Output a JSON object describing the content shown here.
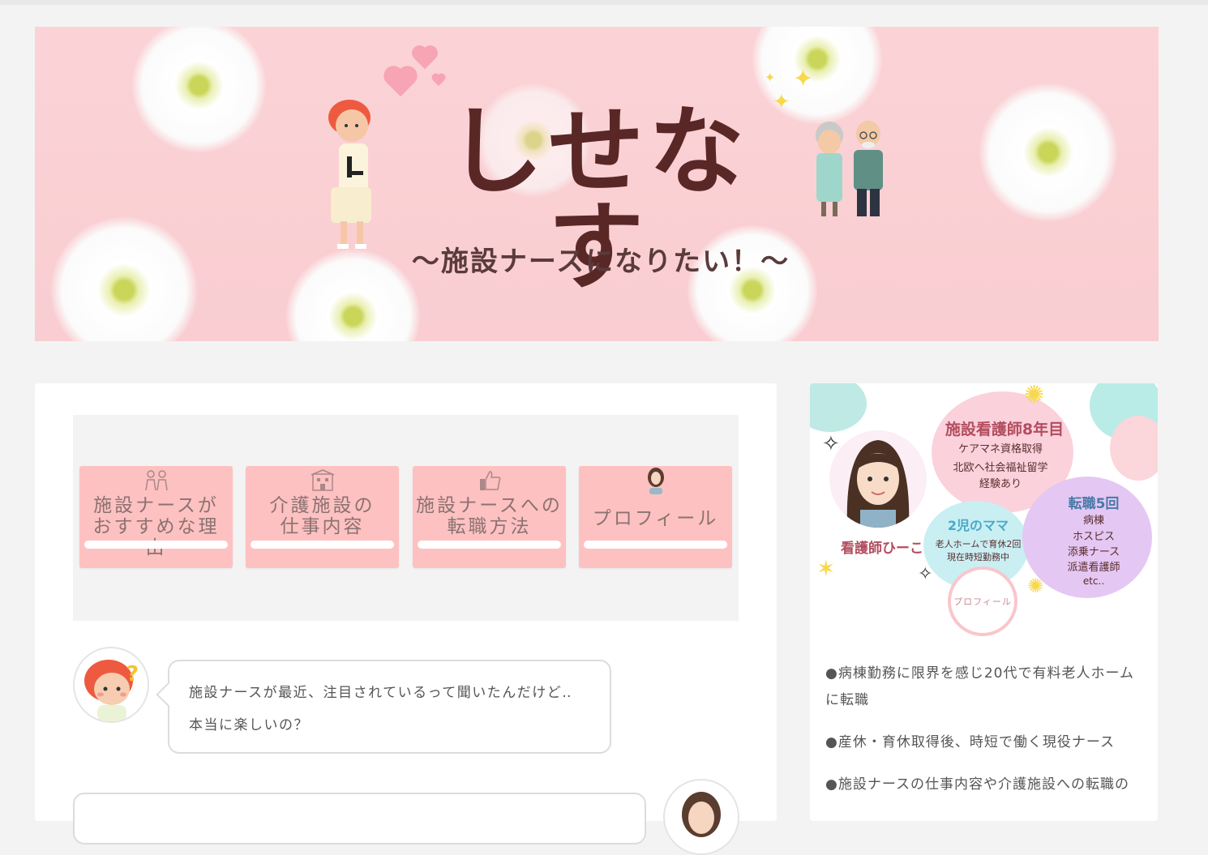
{
  "header": {
    "title": "しせなす",
    "subtitle": "〜施設ナースになりたい！〜"
  },
  "nav": {
    "cards": [
      {
        "label": "施設ナースが\nおすすめな理由",
        "icon": "family-icon"
      },
      {
        "label": "介護施設の\n仕事内容",
        "icon": "building-icon"
      },
      {
        "label": "施設ナースへの\n転職方法",
        "icon": "thumbs-up-icon"
      },
      {
        "label": "プロフィール",
        "icon": "nurse-avatar-icon"
      }
    ]
  },
  "conversation": {
    "line1": "施設ナースが最近、注目されているって聞いたんだけど‥",
    "line2": "本当に楽しいの？"
  },
  "profile_card": {
    "heading": "施設看護師8年目",
    "line1": "ケアマネ資格取得",
    "line2": "北欧へ社会福祉留学",
    "line3": "経験あり",
    "name": "看護師ひーこ",
    "mama": "2児のママ",
    "work1": "老人ホームで育休2回",
    "work2": "現在時短勤務中",
    "career_title": "転職5回",
    "career": [
      "病棟",
      "ホスピス",
      "添乗ナース",
      "派遣看護師",
      "etc.."
    ],
    "button": "プロフィール"
  },
  "sidebar": {
    "bullets": [
      "●病棟勤務に限界を感じ20代で有料老人ホーム",
      "に転職",
      "●産休・育休取得後、時短で働く現役ナース",
      "●施設ナースの仕事内容や介護施設への転職の"
    ]
  },
  "colors": {
    "banner": "#fbd3d6",
    "nav_card": "#fec1c1",
    "title": "#5a2727",
    "page_bg": "#f3f3f3"
  }
}
